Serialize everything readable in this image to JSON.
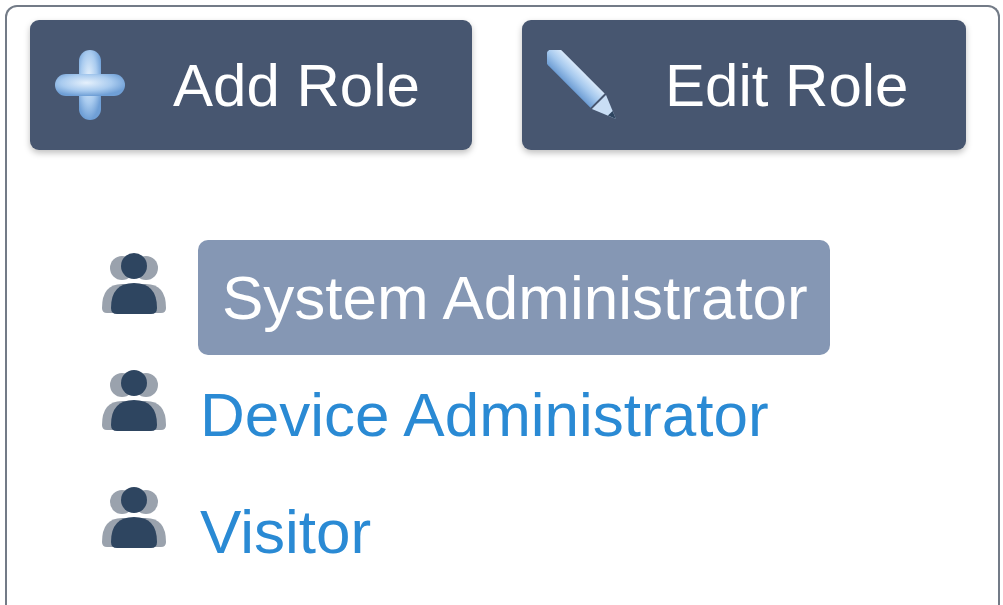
{
  "toolbar": {
    "buttons": [
      {
        "label": "Add Role",
        "kind": "add"
      },
      {
        "label": "Edit Role",
        "kind": "edit"
      }
    ]
  },
  "roles": [
    {
      "label": "System Administrator",
      "selected": true
    },
    {
      "label": "Device Administrator",
      "selected": false
    },
    {
      "label": "Visitor",
      "selected": false
    }
  ]
}
